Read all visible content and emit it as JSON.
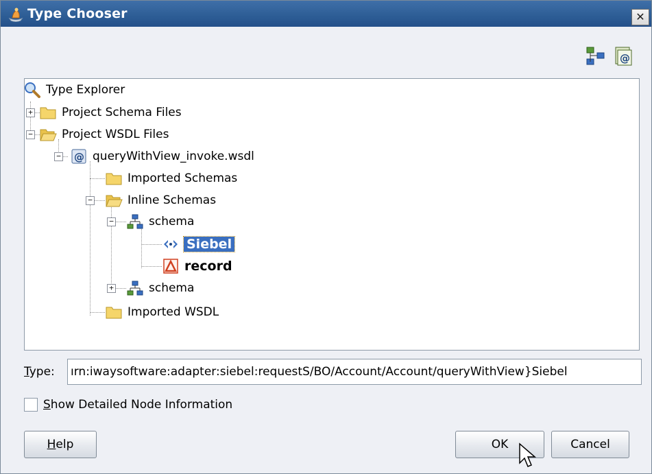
{
  "window": {
    "title": "Type Chooser",
    "close_glyph": "✕"
  },
  "toolbar": {
    "icons": [
      "add-schema-icon",
      "add-wsdl-icon"
    ]
  },
  "tree": {
    "root": "Type Explorer",
    "project_schema_files": "Project Schema Files",
    "project_wsdl_files": "Project WSDL Files",
    "wsdl_file": "queryWithView_invoke.wsdl",
    "imported_schemas": "Imported Schemas",
    "inline_schemas": "Inline Schemas",
    "schema_1": "schema",
    "siebel": "Siebel",
    "record": "record",
    "schema_2": "schema",
    "imported_wsdl": "Imported WSDL"
  },
  "type_field": {
    "label_prefix": "",
    "label_underlined": "T",
    "label_rest": "ype:",
    "value": "ırn:iwaysoftware:adapter:siebel:requestS/BO/Account/Account/queryWithView}Siebel"
  },
  "options": {
    "detail_underlined": "S",
    "detail_rest": "how Detailed Node Information",
    "detail_checked": false
  },
  "buttons": {
    "help_underlined": "H",
    "help_rest": "elp",
    "ok": "OK",
    "cancel": "Cancel"
  },
  "colors": {
    "title_bar": "#2d5d95",
    "selection": "#3a6fc0",
    "folder": "#f5d56a"
  }
}
